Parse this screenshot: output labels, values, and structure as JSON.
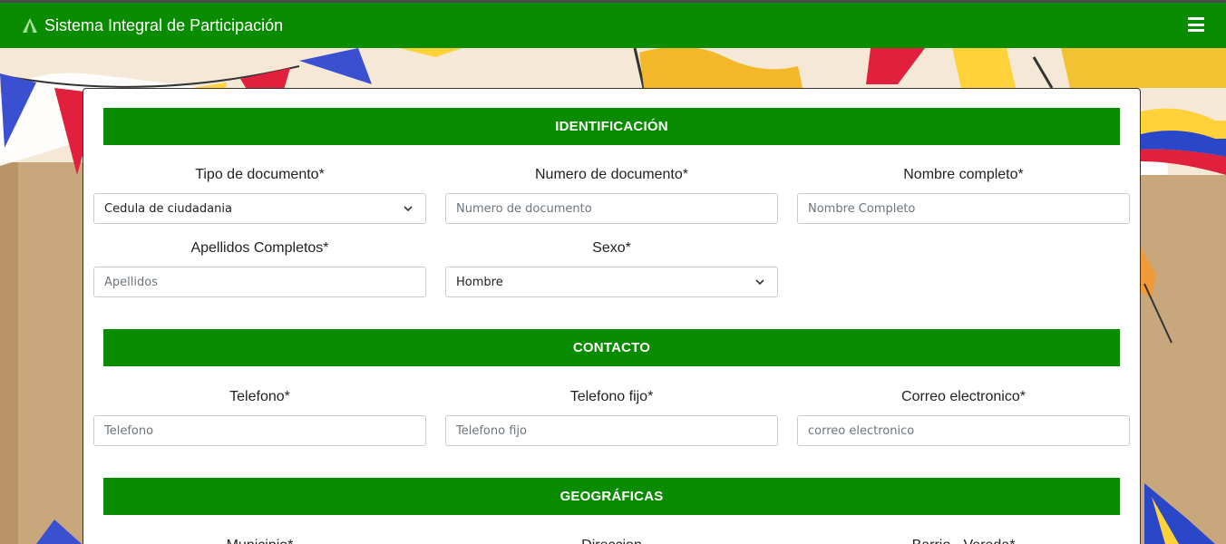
{
  "header": {
    "title": "Sistema Integral de Participación",
    "logo_icon": "a-logo-icon",
    "menu_icon": "hamburger-menu-icon"
  },
  "colors": {
    "primary_green": "#0a8c00",
    "background": "#f6e8d6"
  },
  "sections": {
    "identificacion": {
      "title": "IDENTIFICACIÓN",
      "tipo_documento": {
        "label": "Tipo de documento*",
        "value": "Cedula de ciudadania",
        "options": [
          "Cedula de ciudadania"
        ]
      },
      "numero_documento": {
        "label": "Numero de documento*",
        "placeholder": "Numero de documento"
      },
      "nombre_completo": {
        "label": "Nombre completo*",
        "placeholder": "Nombre Completo"
      },
      "apellidos": {
        "label": "Apellidos Completos*",
        "placeholder": "Apellidos"
      },
      "sexo": {
        "label": "Sexo*",
        "value": "Hombre",
        "options": [
          "Hombre"
        ]
      }
    },
    "contacto": {
      "title": "CONTACTO",
      "telefono": {
        "label": "Telefono*",
        "placeholder": "Telefono"
      },
      "telefono_fijo": {
        "label": "Telefono fijo*",
        "placeholder": "Telefono fijo"
      },
      "correo": {
        "label": "Correo electronico*",
        "placeholder": "correo electronico"
      }
    },
    "geograficas": {
      "title": "GEOGRÁFICAS",
      "municipio": {
        "label": "Municipio*"
      },
      "direccion": {
        "label": "Direccion"
      },
      "barrio": {
        "label": "Barrio - Vereda*"
      }
    }
  }
}
